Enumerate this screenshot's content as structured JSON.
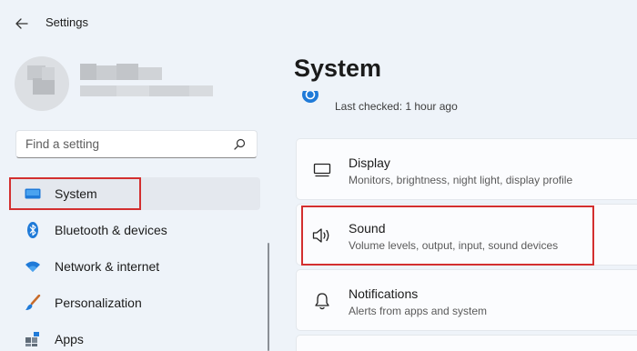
{
  "window": {
    "title": "Settings"
  },
  "search": {
    "placeholder": "Find a setting"
  },
  "nav": {
    "items": [
      {
        "label": "System",
        "icon": "system-monitor-icon",
        "selected": true
      },
      {
        "label": "Bluetooth & devices",
        "icon": "bluetooth-icon"
      },
      {
        "label": "Network & internet",
        "icon": "wifi-icon"
      },
      {
        "label": "Personalization",
        "icon": "paintbrush-icon"
      },
      {
        "label": "Apps",
        "icon": "apps-icon"
      }
    ]
  },
  "main": {
    "title": "System",
    "update_status": "Last checked: 1 hour ago",
    "cards": [
      {
        "title": "Display",
        "description": "Monitors, brightness, night light, display profile",
        "icon": "display-icon"
      },
      {
        "title": "Sound",
        "description": "Volume levels, output, input, sound devices",
        "icon": "speaker-icon"
      },
      {
        "title": "Notifications",
        "description": "Alerts from apps and system",
        "icon": "bell-icon"
      }
    ]
  },
  "colors": {
    "accent": "#0067c0",
    "highlight": "#d32f2f",
    "background": "#eef3f9"
  }
}
